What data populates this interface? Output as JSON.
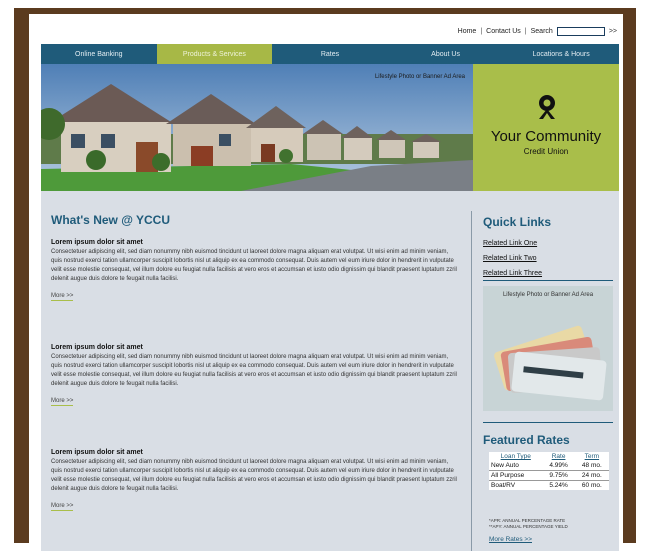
{
  "topbar": {
    "home": "Home",
    "contact": "Contact Us",
    "separator": "|",
    "search_label": "Search",
    "go": ">>"
  },
  "nav": [
    {
      "label": "Online Banking",
      "active": false
    },
    {
      "label": "Products & Services",
      "active": true
    },
    {
      "label": "Rates",
      "active": false
    },
    {
      "label": "About Us",
      "active": false
    },
    {
      "label": "Locations & Hours",
      "active": false
    }
  ],
  "banner": {
    "caption": "Lifestyle Photo or Banner Ad Area",
    "brand_line1": "Your Community",
    "brand_line2": "Credit Union"
  },
  "main": {
    "heading": "What's New @ YCCU",
    "articles": [
      {
        "title": "Lorem ipsum dolor sit amet",
        "body": "Consectetuer adipiscing elit, sed diam nonummy nibh euismod tincidunt ut laoreet dolore magna aliquam erat volutpat.  Ut wisi enim ad minim veniam, quis nostrud exerci tation ullamcorper suscipit lobortis nisl ut aliquip ex ea commodo consequat.  Duis autem vel eum iriure dolor in hendrerit in vulputate velit esse molestie consequat, vel illum dolore eu feugiat nulla facilisis at vero eros et accumsan et iusto odio dignissim qui blandit praesent luptatum zzril delenit augue duis dolore te feugait nulla facilisi.",
        "more": "More >>"
      },
      {
        "title": "Lorem ipsum dolor sit amet",
        "body": "Consectetuer adipiscing elit, sed diam nonummy nibh euismod tincidunt ut laoreet dolore magna aliquam erat volutpat.  Ut wisi enim ad minim veniam, quis nostrud exerci tation ullamcorper suscipit lobortis nisl ut aliquip ex ea commodo consequat.  Duis autem vel eum iriure dolor in hendrerit in vulputate velit esse molestie consequat, vel illum dolore eu feugiat nulla facilisis at vero eros et accumsan et iusto odio dignissim qui blandit praesent luptatum zzril delenit augue duis dolore te feugait nulla facilisi.",
        "more": "More >>"
      },
      {
        "title": "Lorem ipsum dolor sit amet",
        "body": "Consectetuer adipiscing elit, sed diam nonummy nibh euismod tincidunt ut laoreet dolore magna aliquam erat volutpat.  Ut wisi enim ad minim veniam, quis nostrud exerci tation ullamcorper suscipit lobortis nisl ut aliquip ex ea commodo consequat.  Duis autem vel eum iriure dolor in hendrerit in vulputate velit esse molestie consequat, vel illum dolore eu feugiat nulla facilisis at vero eros et accumsan et iusto odio dignissim qui blandit praesent luptatum zzril delenit augue duis dolore te feugait nulla facilisi.",
        "more": "More >>"
      }
    ]
  },
  "sidebar": {
    "quick_links_title": "Quick Links",
    "links": [
      "Related Link One",
      "Related Link Two",
      "Related Link Three"
    ],
    "ad_caption": "Lifestyle Photo or Banner Ad Area",
    "rates_title": "Featured Rates",
    "rates_headers": [
      "Loan Type",
      "Rate",
      "Term"
    ],
    "rates_rows": [
      [
        "New Auto",
        "4.99%",
        "48 mo."
      ],
      [
        "All Purpose",
        "9.75%",
        "24 mo."
      ],
      [
        "Boat/RV",
        "5.24%",
        "60 mo."
      ]
    ],
    "footnote1": "*APR: ANNUAL PERCENTAGE RATE",
    "footnote2": "**APY: ANNUAL PERCENTAGE YIELD",
    "more_rates": "More Rates >>"
  },
  "colors": {
    "nav_bg": "#1f5b7a",
    "accent_green": "#a9be4a",
    "frame_brown": "#5b3b1f",
    "content_bg": "#d9dee5"
  }
}
